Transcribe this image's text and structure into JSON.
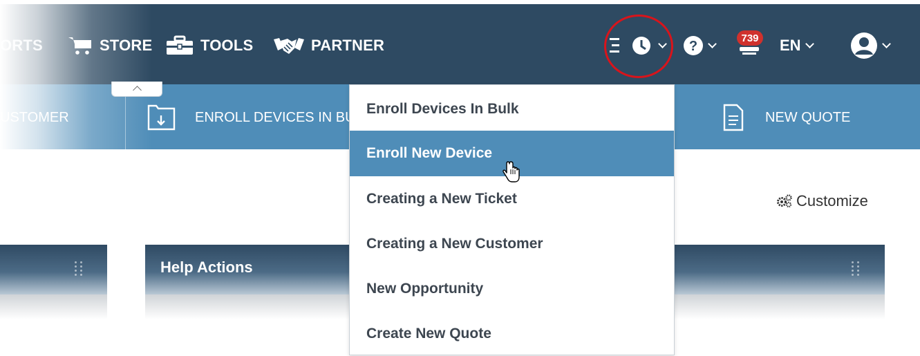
{
  "topnav": {
    "items": [
      {
        "label": "ORTS",
        "icon": "reports-icon"
      },
      {
        "label": "STORE",
        "icon": "cart-icon"
      },
      {
        "label": "TOOLS",
        "icon": "toolbox-icon"
      },
      {
        "label": "PARTNER",
        "icon": "handshake-icon"
      }
    ],
    "notification_count": "739",
    "language": "EN",
    "colors": {
      "bar": "#2e4a62",
      "badge": "#d0312d",
      "highlight": "#d9141b"
    }
  },
  "quickbar": {
    "items": [
      {
        "label": "USTOMER"
      },
      {
        "label": "ENROLL DEVICES IN BU",
        "icon": "enroll-bulk-icon"
      },
      {
        "label": "NEW QUOTE",
        "icon": "document-icon"
      }
    ],
    "color": "#4f8db8"
  },
  "dropdown": {
    "items": [
      {
        "label": "Enroll Devices In Bulk"
      },
      {
        "label": "Enroll New Device",
        "active": true
      },
      {
        "label": "Creating a New Ticket"
      },
      {
        "label": "Creating a New Customer"
      },
      {
        "label": "New Opportunity"
      },
      {
        "label": "Create New Quote"
      }
    ]
  },
  "dashboard": {
    "customize_label": "Customize",
    "widgets": [
      {
        "title": ""
      },
      {
        "title": "Help Actions"
      }
    ]
  }
}
